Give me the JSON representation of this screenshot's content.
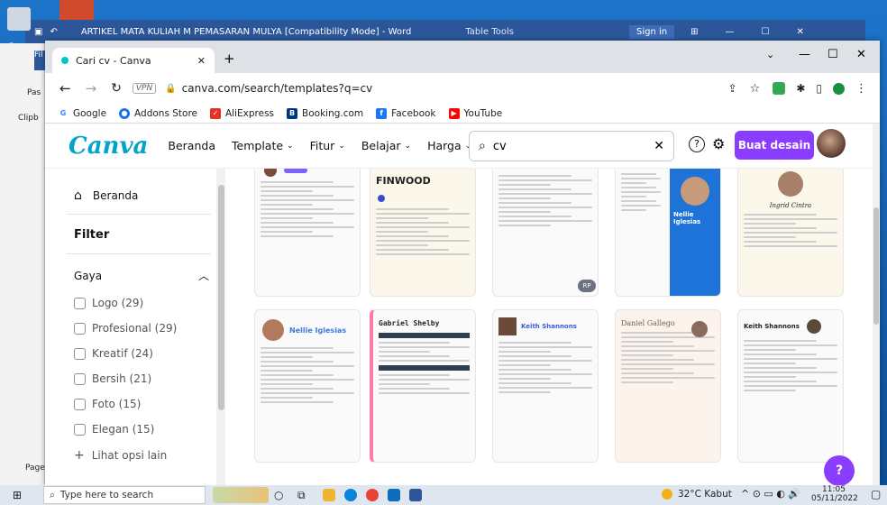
{
  "word": {
    "title": "ARTIKEL MATA KULIAH M PEMASARAN MULYA [Compatibility Mode] - Word",
    "table_tools": "Table Tools",
    "sign_in": "Sign in",
    "left_labels": {
      "file": "Fil",
      "paste": "Pas",
      "clipboard": "Clipb",
      "page": "Page",
      "recycle": "Re"
    }
  },
  "chrome": {
    "tab_title": "Cari cv - Canva",
    "url": "canva.com/search/templates?q=cv",
    "vpn": "VPN",
    "bookmarks": [
      {
        "label": "Google",
        "color": "#4285f4",
        "glyph": "G"
      },
      {
        "label": "Addons Store",
        "color": "#1a73e8",
        "glyph": "A"
      },
      {
        "label": "AliExpress",
        "color": "#e43225",
        "glyph": "A"
      },
      {
        "label": "Booking.com",
        "color": "#003580",
        "glyph": "B"
      },
      {
        "label": "Facebook",
        "color": "#1877f2",
        "glyph": "f"
      },
      {
        "label": "YouTube",
        "color": "#ff0000",
        "glyph": "▶"
      }
    ]
  },
  "canva": {
    "logo": "Canva",
    "nav": [
      "Beranda",
      "Template",
      "Fitur",
      "Belajar",
      "Harga"
    ],
    "search_value": "cv",
    "create_button": "Buat desain",
    "sidebar": {
      "home": "Beranda",
      "filter": "Filter",
      "style_heading": "Gaya",
      "options": [
        "Logo (29)",
        "Profesional (29)",
        "Kreatif (24)",
        "Bersih (21)",
        "Foto (15)",
        "Elegan (15)"
      ],
      "more": "Lihat opsi lain"
    },
    "templates_row1": [
      {
        "head": "",
        "accent": "#7b61ff"
      },
      {
        "head": "FINWOOD",
        "accent": "#3b4cca"
      },
      {
        "head": "",
        "accent": "#5a6b7a",
        "badge": "RP"
      },
      {
        "head": "Nellie Iglesias",
        "accent": "#1e73d8"
      },
      {
        "head": "Ingrid Cintra",
        "accent": "#b89a5a"
      }
    ],
    "templates_row2": [
      {
        "head": "Nellie Iglesias",
        "accent": "#3d7be0"
      },
      {
        "head": "Gabriel Shelby",
        "accent": "#2c3e50"
      },
      {
        "head": "Keith Shannons",
        "accent": "#3b5bdb"
      },
      {
        "head": "Daniel Gallego",
        "accent": "#c98a6a"
      },
      {
        "head": "Keith Shannons",
        "accent": "#2e7d32"
      }
    ],
    "help_badge": "?"
  },
  "taskbar": {
    "search_placeholder": "Type here to search",
    "weather": "32°C  Kabut",
    "time": "11:05",
    "date": "05/11/2022"
  }
}
